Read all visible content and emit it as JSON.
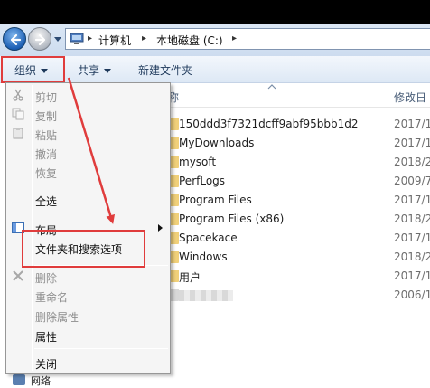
{
  "address_bar": {
    "crumbs": [
      "计算机",
      "本地磁盘 (C:)"
    ]
  },
  "command_bar": {
    "organize": "组织",
    "share": "共享",
    "new_folder": "新建文件夹"
  },
  "file_list": {
    "name_header": "称",
    "date_header": "修改日",
    "rows": [
      {
        "name": "150ddd3f7321dcff9abf95bbb1d2",
        "date": "2017/1"
      },
      {
        "name": "MyDownloads",
        "date": "2017/1"
      },
      {
        "name": "mysoft",
        "date": "2018/2"
      },
      {
        "name": "PerfLogs",
        "date": "2009/7"
      },
      {
        "name": "Program Files",
        "date": "2017/1"
      },
      {
        "name": "Program Files (x86)",
        "date": "2018/2"
      },
      {
        "name": "Spacekace",
        "date": "2017/1"
      },
      {
        "name": "Windows",
        "date": "2018/2"
      },
      {
        "name": "用户",
        "date": "2017/1"
      },
      {
        "name": "",
        "date": "2006/1"
      }
    ]
  },
  "organize_menu": {
    "items": [
      {
        "label": "剪切",
        "enabled": false,
        "icon": "scissors-icon"
      },
      {
        "label": "复制",
        "enabled": false,
        "icon": "copy-icon"
      },
      {
        "label": "粘贴",
        "enabled": false,
        "icon": "paste-icon"
      },
      {
        "label": "撤消",
        "enabled": false,
        "icon": ""
      },
      {
        "label": "恢复",
        "enabled": false,
        "icon": ""
      },
      {
        "label": "全选",
        "enabled": true,
        "icon": ""
      },
      {
        "label": "布局",
        "enabled": true,
        "icon": "layout-icon",
        "submenu": true
      },
      {
        "label": "文件夹和搜索选项",
        "enabled": true,
        "icon": ""
      },
      {
        "label": "删除",
        "enabled": false,
        "icon": "delete-x-icon"
      },
      {
        "label": "重命名",
        "enabled": false,
        "icon": ""
      },
      {
        "label": "删除属性",
        "enabled": false,
        "icon": ""
      },
      {
        "label": "属性",
        "enabled": true,
        "icon": ""
      },
      {
        "label": "关闭",
        "enabled": true,
        "icon": ""
      }
    ]
  },
  "left_nav": {
    "partial_label": "网络"
  },
  "colors": {
    "annotation_red": "#e03c3c",
    "command_text": "#1e395b"
  }
}
